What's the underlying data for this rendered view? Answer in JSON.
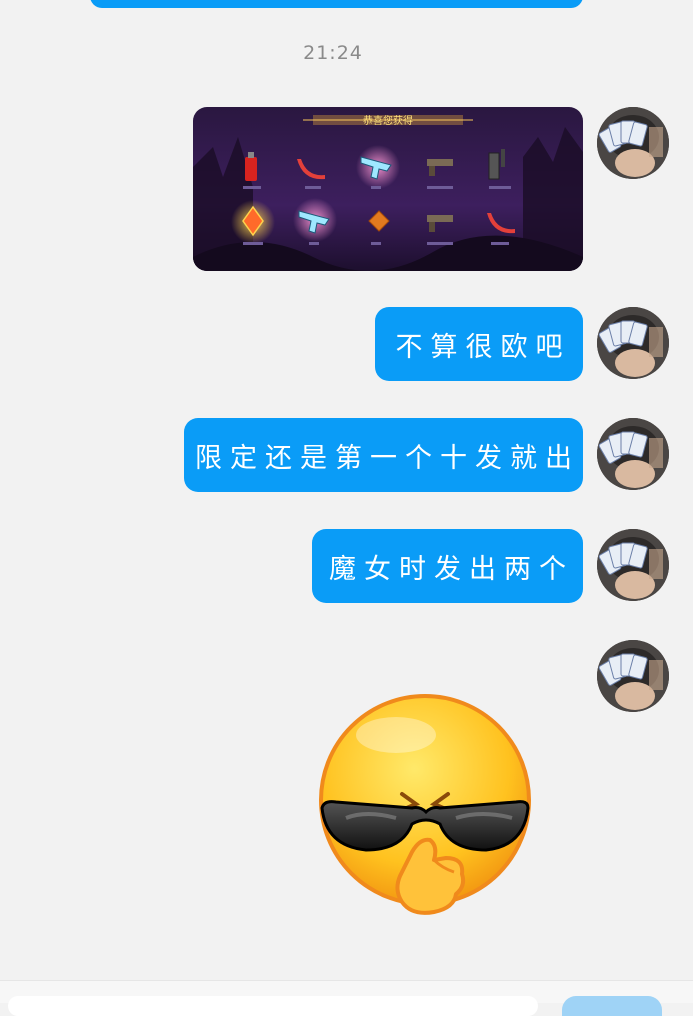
{
  "timestamp": "21:24",
  "image_message": {
    "banner_text": "恭喜您获得",
    "item_labels": [
      "",
      "",
      "",
      "",
      "",
      "",
      "",
      "",
      "",
      ""
    ]
  },
  "messages": [
    {
      "text": "不算很欧吧"
    },
    {
      "text": "限定还是第一个十发就出"
    },
    {
      "text": "魔女时发出两个"
    }
  ],
  "sticker": {
    "name": "sunglasses-cool-emoji"
  },
  "colors": {
    "bubble": "#0a9cf7",
    "background": "#f2f2f2",
    "timestamp": "#8a8a8a"
  }
}
